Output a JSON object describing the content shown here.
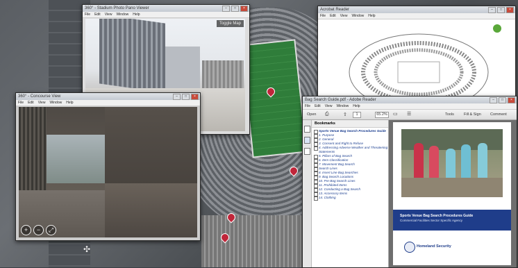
{
  "pano_back": {
    "title": "360° - Stadium Photo Pano Viewer",
    "menu": [
      "File",
      "Edit",
      "View",
      "Window",
      "Help"
    ],
    "toggle_label": "Toggle Map",
    "controls": [
      "+",
      "−",
      "⤢"
    ]
  },
  "pano_front": {
    "title": "360° - Concourse View",
    "menu": [
      "File",
      "Edit",
      "View",
      "Window",
      "Help"
    ],
    "controls": [
      "+",
      "−",
      "⤢"
    ]
  },
  "acrobat_back": {
    "title": "Acrobat Reader",
    "menu": [
      "File",
      "Edit",
      "View",
      "Window",
      "Help"
    ]
  },
  "acrobat_front": {
    "title": "Bag Search Guide.pdf - Adobe Reader",
    "menu": [
      "File",
      "Edit",
      "View",
      "Window",
      "Help"
    ],
    "toolbar": {
      "open": "Open",
      "page": "1",
      "zoom": "65.2%",
      "tools": "Tools",
      "fill_sign": "Fill & Sign",
      "comment": "Comment"
    },
    "bookmarks_header": "Bookmarks",
    "bookmarks": [
      "Sports Venue Bag Search Procedures Guide",
      "1. Purpose",
      "2. General",
      "3. Consent and Right to Refuse",
      "4. Addressing Adverse Weather and Threatening Statements",
      "5. Pillars of Bag Search",
      "6. Item Classification",
      "7. Movement Bag Search",
      "Search Lines",
      "8. Insert Line Bag Searches",
      "9. Bag Search Locations",
      "10. Pre-Bag Search Lines",
      "11. Prohibited Items",
      "12. Conducting a Bag Search",
      "13. Accessory Items",
      "14. Clothing"
    ],
    "doc_title": "Sports Venue Bag Search Procedures Guide",
    "doc_subtitle": "Commercial Facilities Sector Specific Agency",
    "dhs_name": "Homeland Security"
  },
  "colors": {
    "dhs_blue": "#1f3d8a",
    "field_green": "#2f7d3a",
    "pin_red": "#c0263a"
  }
}
